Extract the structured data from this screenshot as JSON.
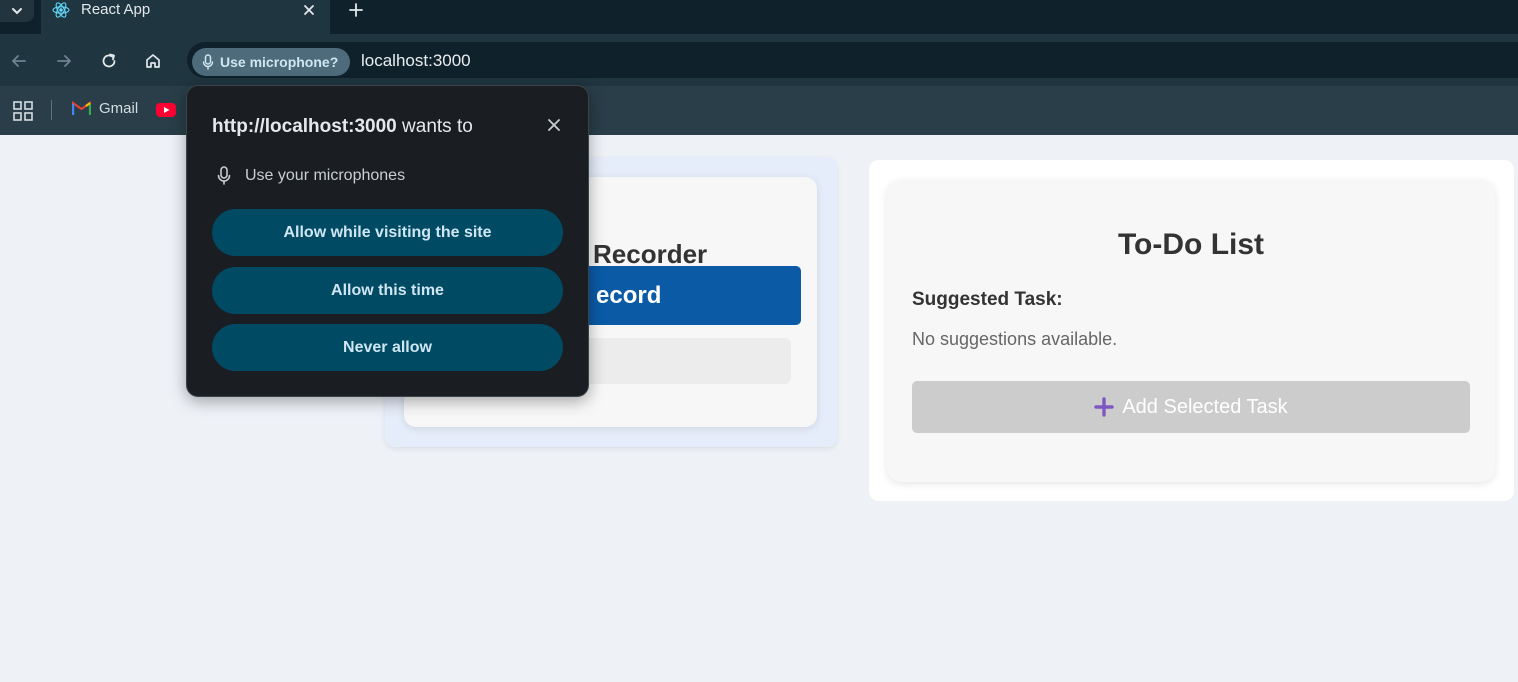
{
  "browser": {
    "tab": {
      "title": "React App"
    },
    "toolbar": {
      "permission_chip": "Use microphone?",
      "url": "localhost:3000"
    },
    "bookmarks": [
      {
        "label": "Gmail",
        "icon": "gmail-icon"
      },
      {
        "label": "",
        "icon": "youtube-icon"
      }
    ]
  },
  "popup": {
    "origin": "http://localhost:3000",
    "title_suffix": " wants to",
    "permission": "Use your microphones",
    "buttons": {
      "allow_visit": "Allow while visiting the site",
      "allow_once": "Allow this time",
      "never": "Never allow"
    }
  },
  "recorder": {
    "title_visible": "Recorder",
    "record_button_visible": "ecord"
  },
  "todo": {
    "title": "To-Do List",
    "suggested_heading": "Suggested Task:",
    "empty_message": "No suggestions available.",
    "add_button": "Add Selected Task"
  },
  "colors": {
    "record_button": "#0a5aa6",
    "popup_button": "#004a63",
    "add_icon": "#7e57c2",
    "chip": "#4d6b7b"
  }
}
